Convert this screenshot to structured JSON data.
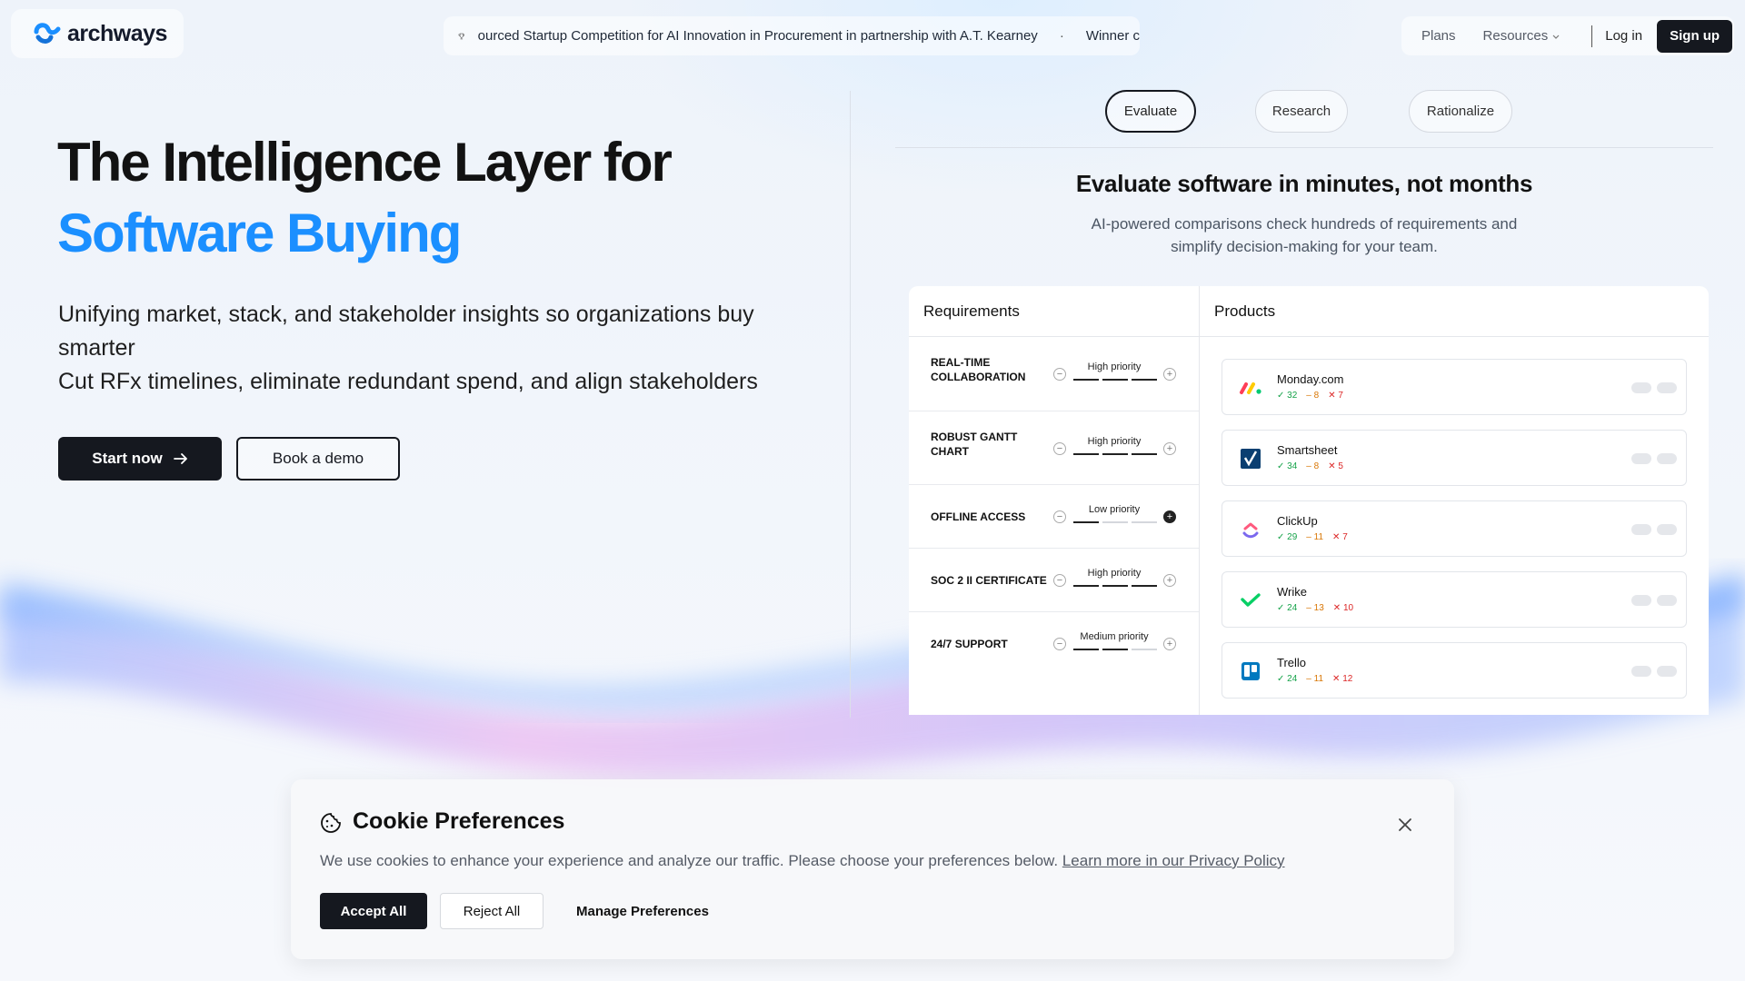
{
  "brand": {
    "name": "archways",
    "accent": "#1b8fff",
    "dark": "#15181f"
  },
  "ticker": {
    "icon": "trophy-icon",
    "text": "ourced Startup Competition for AI Innovation in Procurement in partnership with A.T. Kearney",
    "separator": "·",
    "next": "Winner c"
  },
  "nav": {
    "plans": "Plans",
    "resources": "Resources",
    "login": "Log in",
    "signup": "Sign up"
  },
  "hero": {
    "title_line1": "The Intelligence Layer for",
    "title_line2": "Software Buying",
    "sub_line1": "Unifying market, stack, and stakeholder insights so organizations buy smarter",
    "sub_line2": "Cut RFx timelines, eliminate redundant spend, and align stakeholders",
    "start_now": "Start now",
    "book_demo": "Book a demo"
  },
  "tabs": [
    {
      "label": "Evaluate",
      "active": true
    },
    {
      "label": "Research",
      "active": false
    },
    {
      "label": "Rationalize",
      "active": false
    }
  ],
  "section": {
    "title": "Evaluate software in minutes, not months",
    "desc": "AI-powered comparisons check hundreds of requirements and simplify decision-making for your team."
  },
  "comparison": {
    "requirements_header": "Requirements",
    "products_header": "Products",
    "requirements": [
      {
        "label": "REAL-TIME COLLABORATION",
        "priority": "High priority",
        "level": 3
      },
      {
        "label": "ROBUST GANTT CHART",
        "priority": "High priority",
        "level": 3
      },
      {
        "label": "OFFLINE ACCESS",
        "priority": "Low priority",
        "level": 1
      },
      {
        "label": "SOC 2 II CERTIFICATE",
        "priority": "High priority",
        "level": 3
      },
      {
        "label": "24/7 SUPPORT",
        "priority": "Medium priority",
        "level": 2
      }
    ],
    "products": [
      {
        "name": "Monday.com",
        "yes": "32",
        "mid": "8",
        "no": "7"
      },
      {
        "name": "Smartsheet",
        "yes": "34",
        "mid": "8",
        "no": "5"
      },
      {
        "name": "ClickUp",
        "yes": "29",
        "mid": "11",
        "no": "7"
      },
      {
        "name": "Wrike",
        "yes": "24",
        "mid": "13",
        "no": "10"
      },
      {
        "name": "Trello",
        "yes": "24",
        "mid": "11",
        "no": "12"
      }
    ]
  },
  "cookie": {
    "title": "Cookie Preferences",
    "text": "We use cookies to enhance your experience and analyze our traffic. Please choose your preferences below.",
    "link": "Learn more in our Privacy Policy",
    "accept": "Accept All",
    "reject": "Reject All",
    "manage": "Manage Preferences"
  }
}
